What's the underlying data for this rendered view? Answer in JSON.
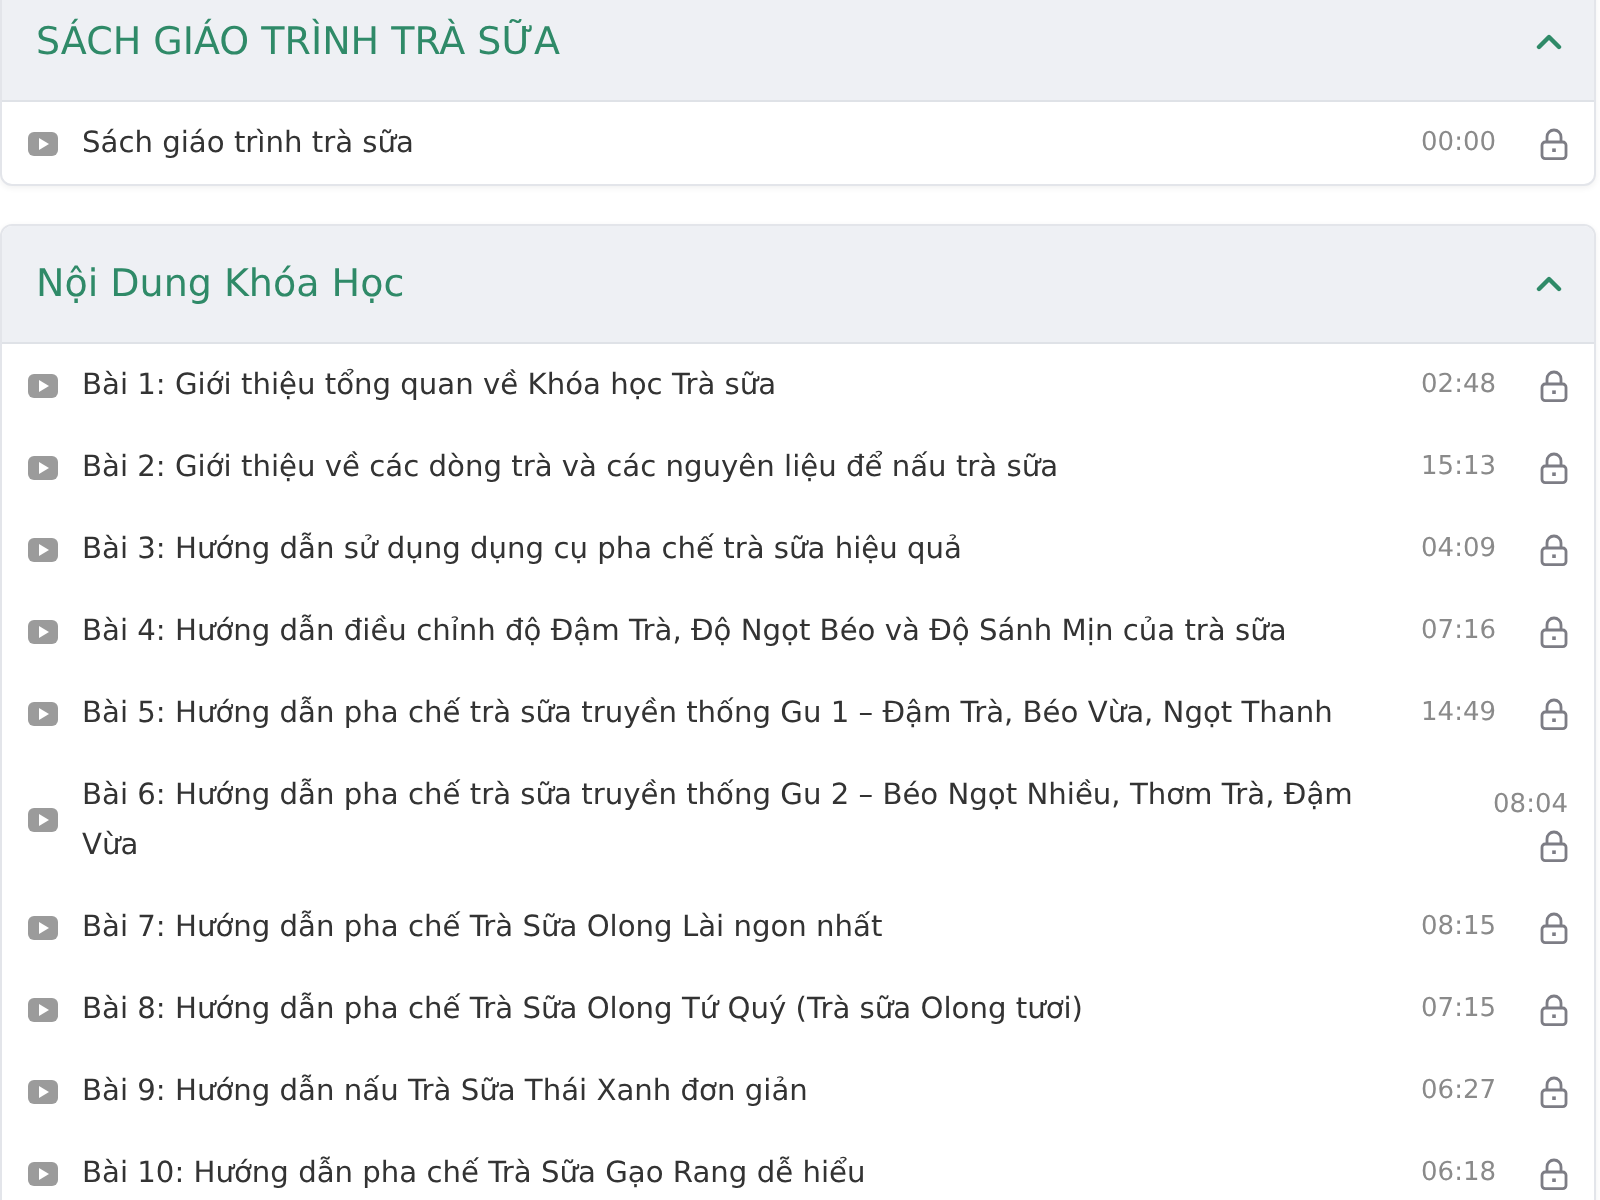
{
  "sections": [
    {
      "title": "SÁCH GIÁO TRÌNH TRÀ SỮA",
      "expanded": true,
      "lessons": [
        {
          "title": "Sách giáo trình trà sữa",
          "duration": "00:00",
          "locked": true
        }
      ]
    },
    {
      "title": "Nội Dung Khóa Học",
      "expanded": true,
      "lessons": [
        {
          "title": "Bài 1: Giới thiệu tổng quan về Khóa học Trà sữa",
          "duration": "02:48",
          "locked": true
        },
        {
          "title": "Bài 2: Giới thiệu về các dòng trà và các nguyên liệu để nấu trà sữa",
          "duration": "15:13",
          "locked": true
        },
        {
          "title": "Bài 3: Hướng dẫn sử dụng dụng cụ pha chế trà sữa hiệu quả",
          "duration": "04:09",
          "locked": true
        },
        {
          "title": "Bài 4: Hướng dẫn điều chỉnh độ Đậm Trà, Độ Ngọt Béo và Độ Sánh Mịn của trà sữa",
          "duration": "07:16",
          "locked": true
        },
        {
          "title": "Bài 5: Hướng dẫn pha chế trà sữa truyền thống Gu 1 – Đậm Trà, Béo Vừa, Ngọt Thanh",
          "duration": "14:49",
          "locked": true
        },
        {
          "title": "Bài 6: Hướng dẫn pha chế trà sữa truyền thống Gu 2 – Béo Ngọt Nhiều, Thơm Trà, Đậm Vừa",
          "duration": "08:04",
          "locked": true
        },
        {
          "title": "Bài 7: Hướng dẫn pha chế Trà Sữa Olong Lài ngon nhất",
          "duration": "08:15",
          "locked": true
        },
        {
          "title": "Bài 8: Hướng dẫn pha chế Trà Sữa Olong Tứ Quý (Trà sữa Olong tươi)",
          "duration": "07:15",
          "locked": true
        },
        {
          "title": "Bài 9: Hướng dẫn nấu Trà Sữa Thái Xanh đơn giản",
          "duration": "06:27",
          "locked": true
        },
        {
          "title": "Bài 10: Hướng dẫn pha chế Trà Sữa Gạo Rang dễ hiểu",
          "duration": "06:18",
          "locked": true
        }
      ]
    }
  ]
}
